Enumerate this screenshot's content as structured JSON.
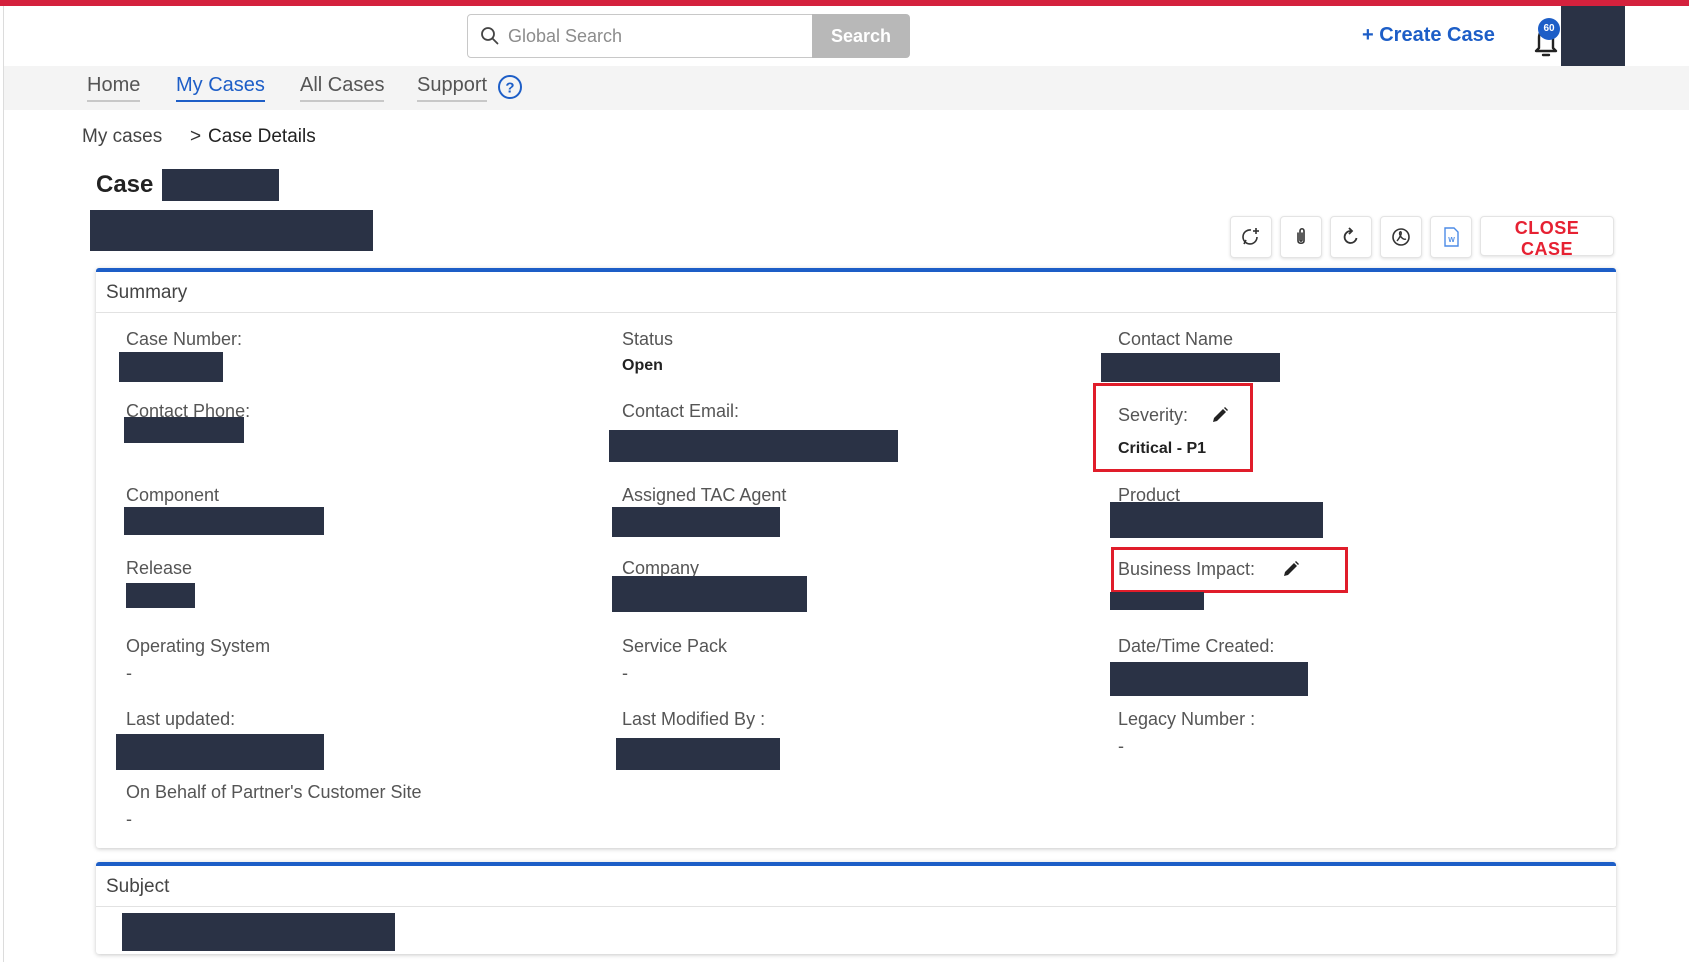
{
  "header": {
    "search_placeholder": "Global Search",
    "search_button": "Search",
    "create_case": "+ Create Case",
    "notification_count": "60"
  },
  "nav": {
    "items": [
      {
        "label": "Home"
      },
      {
        "label": "My Cases",
        "active": true
      },
      {
        "label": "All Cases"
      },
      {
        "label": "Support"
      }
    ]
  },
  "breadcrumb": {
    "parent": "My cases",
    "separator": ">",
    "current": "Case Details"
  },
  "case": {
    "title_prefix": "Case"
  },
  "toolbar": {
    "close_case": "CLOSE CASE"
  },
  "summary": {
    "title": "Summary",
    "fields": {
      "case_number": "Case Number:",
      "status": "Status",
      "status_value": "Open",
      "contact_name": "Contact Name",
      "contact_phone": "Contact Phone:",
      "contact_email": "Contact Email:",
      "severity": "Severity:",
      "severity_value": "Critical - P1",
      "component": "Component",
      "assigned_tac_agent": "Assigned TAC Agent",
      "product": "Product",
      "release": "Release",
      "company": "Company",
      "business_impact": "Business Impact:",
      "operating_system": "Operating System",
      "operating_system_value": "-",
      "service_pack": "Service Pack",
      "service_pack_value": "-",
      "date_time_created": "Date/Time Created:",
      "last_updated": "Last updated:",
      "last_modified_by": "Last Modified By :",
      "legacy_number": "Legacy Number :",
      "legacy_number_value": "-",
      "on_behalf": "On Behalf of Partner's Customer Site",
      "on_behalf_value": "-"
    }
  },
  "subject": {
    "title": "Subject"
  },
  "colors": {
    "accent": "#1d5ec7",
    "brand_red": "#d4213d",
    "redaction": "#2a3245",
    "highlight": "#e01d2a"
  }
}
